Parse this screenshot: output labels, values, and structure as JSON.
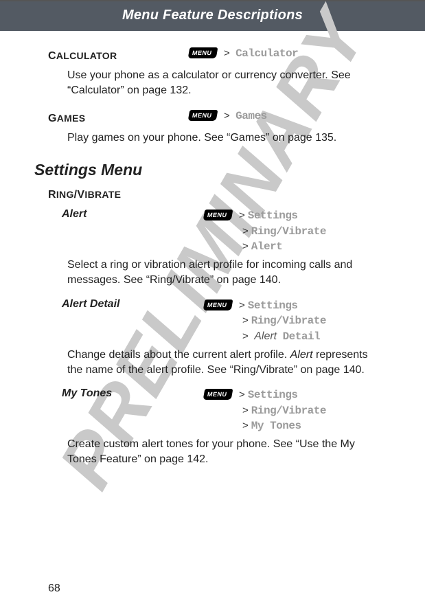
{
  "header": "Menu Feature Descriptions",
  "watermark": "PRELIMINARY",
  "page_number": "68",
  "menu_key_label": "MENU",
  "calc": {
    "title": "CALCULATOR",
    "path": "Calculator",
    "desc": "Use your phone as a calculator or currency converter. See “Calculator” on page 132."
  },
  "games": {
    "title": "GAMES",
    "path": "Games",
    "desc": "Play games on your phone. See “Games” on page 135."
  },
  "settings_heading": "Settings Menu",
  "ringvib_title": "RING/VIBRATE",
  "alert": {
    "title": "Alert",
    "p1": "Settings",
    "p2": "Ring/Vibrate",
    "p3": "Alert",
    "desc": "Select a ring or vibration alert profile for incoming calls and messages. See “Ring/Vibrate” on page 140."
  },
  "alert_detail": {
    "title": "Alert Detail",
    "p1": "Settings",
    "p2": "Ring/Vibrate",
    "p3_prefix": "Alert",
    "p3_suffix": "Detail",
    "desc_a": "Change details about the current alert profile. ",
    "desc_em": "Alert",
    "desc_b": " represents the name of the alert profile. See “Ring/Vibrate” on page 140."
  },
  "mytones": {
    "title": "My Tones",
    "p1": "Settings",
    "p2": "Ring/Vibrate",
    "p3": "My Tones",
    "desc": "Create custom alert tones for your phone. See “Use the My Tones Feature” on page 142."
  }
}
